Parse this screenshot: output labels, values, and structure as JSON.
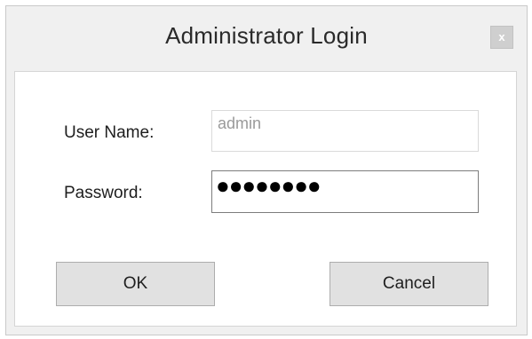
{
  "window": {
    "title": "Administrator Login",
    "close_glyph": "x"
  },
  "form": {
    "username_label": "User Name:",
    "username_value": "admin",
    "password_label": "Password:",
    "password_value": "●●●●●●●●"
  },
  "buttons": {
    "ok_label": "OK",
    "cancel_label": "Cancel"
  }
}
